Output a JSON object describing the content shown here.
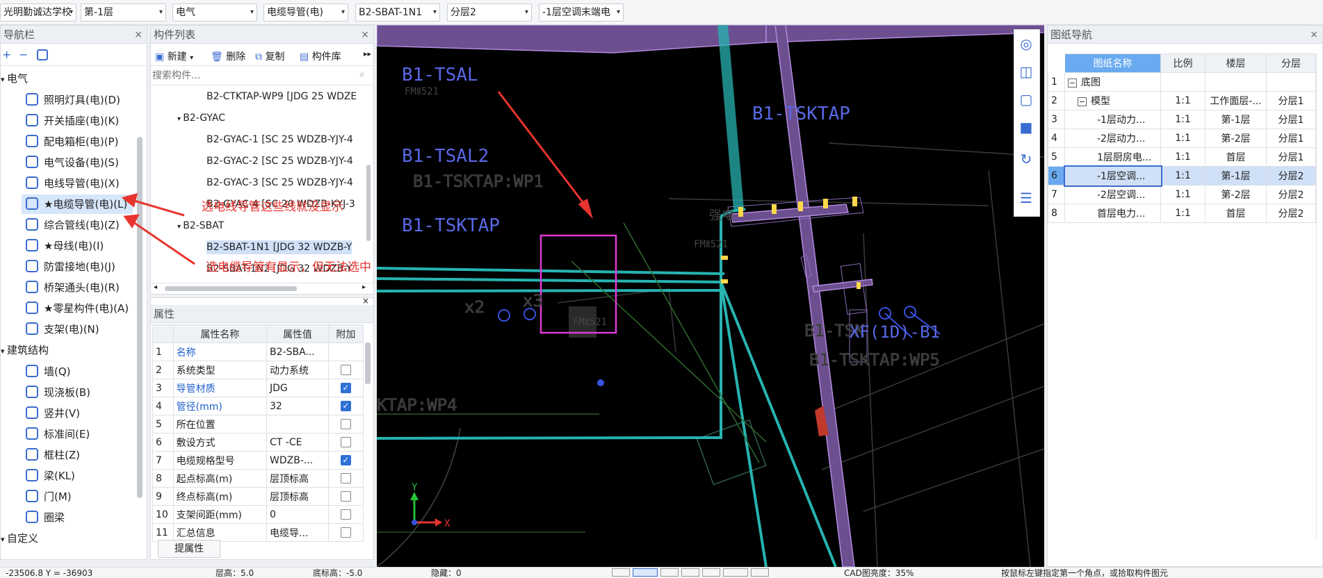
{
  "toolbar": {
    "project": "光明勤诚达学校",
    "floor": "第-1层",
    "discipline": "电气",
    "component_type": "电缆导管(电)",
    "component": "B2-SBAT-1N1",
    "layer": "分层2",
    "drawing": "-1层空调末端电"
  },
  "nav": {
    "title": "导航栏",
    "groups": [
      {
        "label": "电气",
        "items": [
          {
            "label": "照明灯具(电)(D)",
            "icon": "bulb-icon"
          },
          {
            "label": "开关插座(电)(K)",
            "icon": "switch-icon"
          },
          {
            "label": "配电箱柜(电)(P)",
            "icon": "cabinet-icon"
          },
          {
            "label": "电气设备(电)(S)",
            "icon": "device-icon"
          },
          {
            "label": "电线导管(电)(X)",
            "icon": "wire-conduit-icon"
          },
          {
            "label": "★电缆导管(电)(L)",
            "icon": "cable-conduit-icon"
          },
          {
            "label": "综合管线(电)(Z)",
            "icon": "pipeline-icon"
          },
          {
            "label": "★母线(电)(I)",
            "icon": "busbar-icon"
          },
          {
            "label": "防雷接地(电)(J)",
            "icon": "lightning-icon"
          },
          {
            "label": "桥架通头(电)(R)",
            "icon": "tray-fitting-icon"
          },
          {
            "label": "★零星构件(电)(A)",
            "icon": "misc-icon"
          },
          {
            "label": "支架(电)(N)",
            "icon": "bracket-icon"
          }
        ]
      },
      {
        "label": "建筑结构",
        "items": [
          {
            "label": "墙(Q)",
            "icon": "wall-icon"
          },
          {
            "label": "现浇板(B)",
            "icon": "slab-icon"
          },
          {
            "label": "竖井(V)",
            "icon": "shaft-icon"
          },
          {
            "label": "标准间(E)",
            "icon": "room-icon"
          },
          {
            "label": "框柱(Z)",
            "icon": "column-icon"
          },
          {
            "label": "梁(KL)",
            "icon": "beam-icon"
          },
          {
            "label": "门(M)",
            "icon": "door-icon"
          },
          {
            "label": "圈梁",
            "icon": "ring-beam-icon"
          }
        ]
      },
      {
        "label": "自定义",
        "items": []
      }
    ]
  },
  "components": {
    "title": "构件列表",
    "actions": {
      "new": "新建",
      "delete": "删除",
      "copy": "复制",
      "library": "构件库"
    },
    "search_placeholder": "搜索构件...",
    "rows": [
      {
        "text": "B2-CTKTAP-WP9 [JDG 25 WDZE",
        "level": 2
      },
      {
        "text": "B2-GYAC",
        "level": 1
      },
      {
        "text": "B2-GYAC-1 [SC 25 WDZB-YJY-4",
        "level": 2
      },
      {
        "text": "B2-GYAC-2 [SC 25 WDZB-YJY-4",
        "level": 2
      },
      {
        "text": "B2-GYAC-3 [SC 25 WDZB-YJY-4",
        "level": 2
      },
      {
        "text": "B2-GYAC-4 [SC 20 WDZB-KYJ-3",
        "level": 2
      },
      {
        "text": "B2-SBAT",
        "level": 1
      },
      {
        "text": "B2-SBAT-1N1 [JDG 32 WDZB-Y",
        "level": 2
      },
      {
        "text": "B2-SBAT-1N2 [JDG 32 WDZB-Y",
        "level": 2
      }
    ]
  },
  "properties": {
    "title": "属性",
    "headers": [
      "属性名称",
      "属性值",
      "附加"
    ],
    "rows": [
      {
        "n": "1",
        "name": "名称",
        "value": "B2-SBA...",
        "check": null,
        "blue": true
      },
      {
        "n": "2",
        "name": "系统类型",
        "value": "动力系统",
        "check": false,
        "blue": false
      },
      {
        "n": "3",
        "name": "导管材质",
        "value": "JDG",
        "check": true,
        "blue": true
      },
      {
        "n": "4",
        "name": "管径(mm)",
        "value": "32",
        "check": true,
        "blue": true
      },
      {
        "n": "5",
        "name": "所在位置",
        "value": "",
        "check": false,
        "blue": false
      },
      {
        "n": "6",
        "name": "敷设方式",
        "value": "CT -CE",
        "check": false,
        "blue": false
      },
      {
        "n": "7",
        "name": "电缆规格型号",
        "value": "WDZB-...",
        "check": true,
        "blue": false
      },
      {
        "n": "8",
        "name": "起点标高(m)",
        "value": "层顶标高",
        "check": false,
        "blue": false
      },
      {
        "n": "9",
        "name": "终点标高(m)",
        "value": "层顶标高",
        "check": false,
        "blue": false
      },
      {
        "n": "10",
        "name": "支架间距(mm)",
        "value": "0",
        "check": false,
        "blue": false
      },
      {
        "n": "11",
        "name": "汇总信息",
        "value": "电缆导...",
        "check": false,
        "blue": false
      }
    ],
    "button": "提属性"
  },
  "drawing_nav": {
    "title": "图纸导航",
    "headers": [
      "",
      "图纸名称",
      "比例",
      "楼层",
      "分层"
    ],
    "rows": [
      {
        "n": "1",
        "name": "底图",
        "scale": "",
        "floor": "",
        "layer": "",
        "indent": 0,
        "toggle": "−"
      },
      {
        "n": "2",
        "name": "模型",
        "scale": "1:1",
        "floor": "工作面层-...",
        "layer": "分层1",
        "indent": 1,
        "toggle": "−"
      },
      {
        "n": "3",
        "name": "-1层动力...",
        "scale": "1:1",
        "floor": "第-1层",
        "layer": "分层1",
        "indent": 2,
        "toggle": ""
      },
      {
        "n": "4",
        "name": "-2层动力...",
        "scale": "1:1",
        "floor": "第-2层",
        "layer": "分层1",
        "indent": 2,
        "toggle": ""
      },
      {
        "n": "5",
        "name": "1层厨房电...",
        "scale": "1:1",
        "floor": "首层",
        "layer": "分层1",
        "indent": 2,
        "toggle": ""
      },
      {
        "n": "6",
        "name": "-1层空调...",
        "scale": "1:1",
        "floor": "第-1层",
        "layer": "分层2",
        "indent": 2,
        "toggle": "",
        "selected": true
      },
      {
        "n": "7",
        "name": "-2层空调...",
        "scale": "1:1",
        "floor": "第-2层",
        "layer": "分层2",
        "indent": 2,
        "toggle": ""
      },
      {
        "n": "8",
        "name": "首层电力...",
        "scale": "1:1",
        "floor": "首层",
        "layer": "分层2",
        "indent": 2,
        "toggle": ""
      }
    ]
  },
  "cad": {
    "labels": {
      "tsal": "B1-TSAL",
      "tsal2": "B1-TSAL2",
      "tsktap_wp1": "B1-TSKTAP:WP1",
      "tsktap": "B1-TSKTAP",
      "tsktap_right": "B1-TSKTAP",
      "fm1": "FMⅡ521",
      "fm2": "FMⅡ521",
      "fm3": "FMⅡ521",
      "x2": "x2",
      "x3": "x3",
      "xf": "XF(1D)-B1",
      "tsktap_wp5": "B1-TSKTAP:WP5",
      "tsk_partial": "B1-TSK",
      "ktap_wp4": "KTAP:WP4",
      "elec": "强电",
      "axis_x": "X",
      "axis_y": "Y"
    },
    "annotations": {
      "note1": "选电线导管这些线就没显示",
      "note2": "选电缆导管有显示，但无法选中"
    },
    "colors": {
      "conduit": "#27b3b0",
      "tray": "#b48ae0",
      "highlight": "#e23ad6",
      "arrow": "#e8342f"
    }
  },
  "statusbar": {
    "coords": "-23506.8 Y = -36903",
    "floor_height": "层高：5.0",
    "base_elevation": "底标高：-5.0",
    "hidden": "隐藏：0",
    "transparency": "CAD图亮度：35%",
    "hint": "按鼠标左键指定第一个角点，或拾取构件图元"
  },
  "canvas_tools": [
    "orbit-icon",
    "view-3d-icon",
    "view-box-icon",
    "view-cube-icon",
    "rotate-icon",
    "layer-list-icon"
  ]
}
